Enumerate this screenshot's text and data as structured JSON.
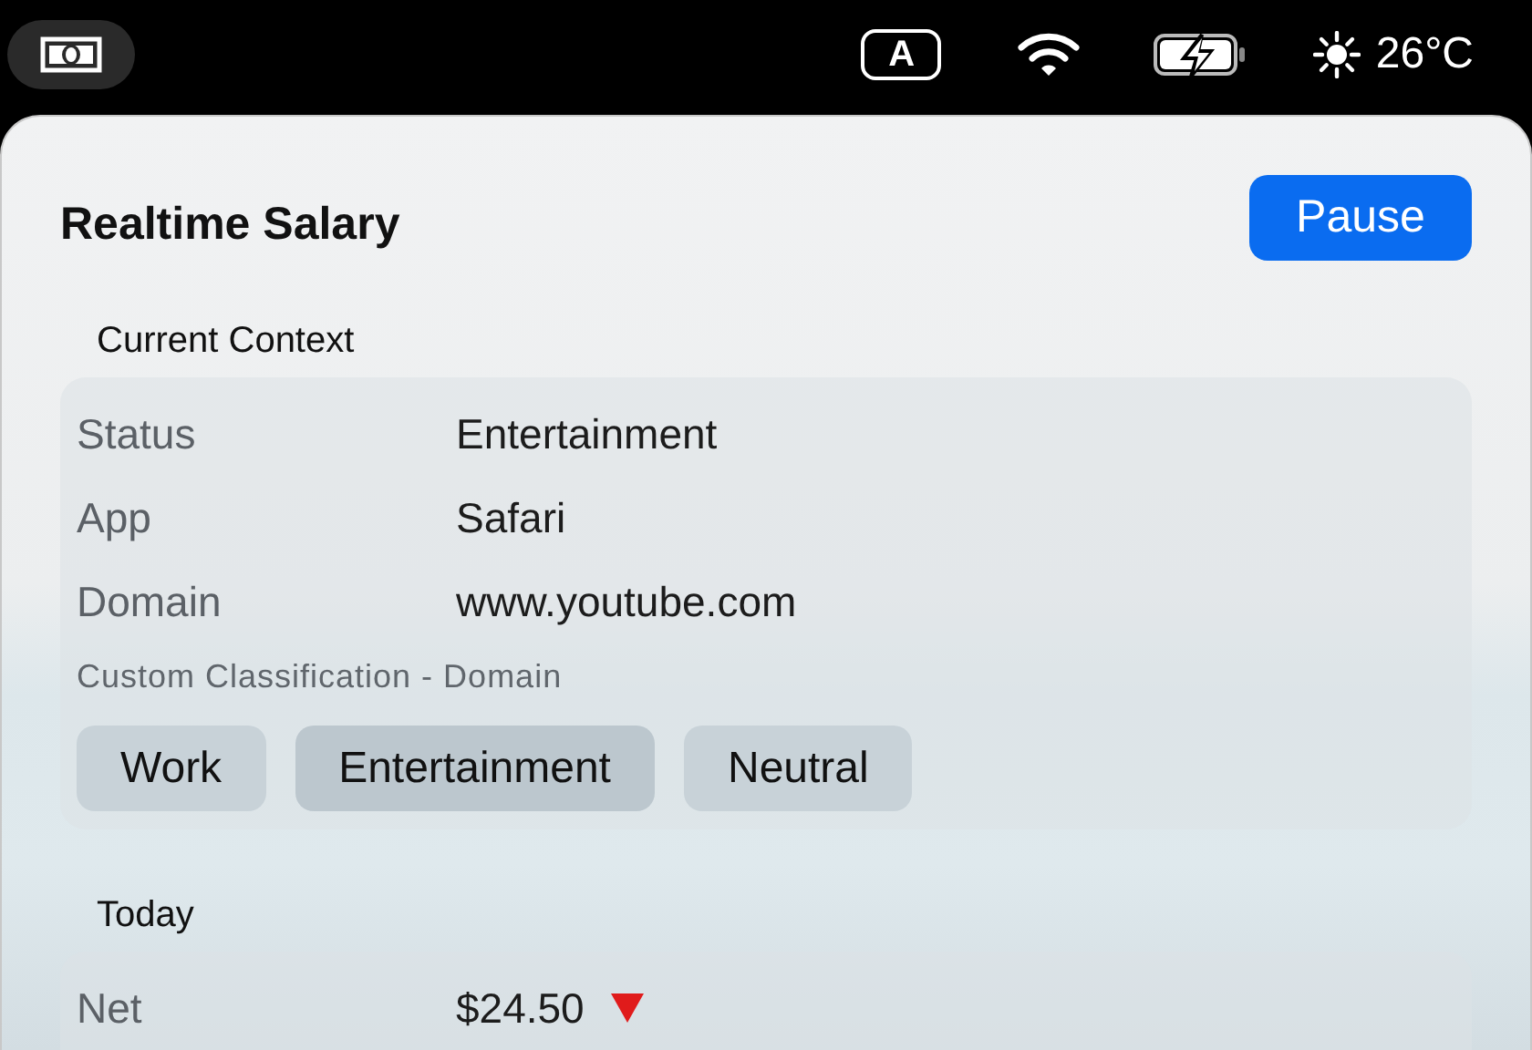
{
  "menu_bar": {
    "temperature": "26°C",
    "input_source": "A"
  },
  "panel": {
    "title": "Realtime Salary",
    "pause_button": "Pause",
    "current_context": {
      "heading": "Current Context",
      "rows": [
        {
          "label": "Status",
          "value": "Entertainment"
        },
        {
          "label": "App",
          "value": "Safari"
        },
        {
          "label": "Domain",
          "value": "www.youtube.com"
        }
      ],
      "classification_label": "Custom Classification - Domain",
      "chips": [
        {
          "label": "Work",
          "selected": false
        },
        {
          "label": "Entertainment",
          "selected": true
        },
        {
          "label": "Neutral",
          "selected": false
        }
      ]
    },
    "today": {
      "heading": "Today",
      "rows": [
        {
          "label": "Net",
          "value": "$24.50",
          "falling": true
        }
      ]
    }
  }
}
